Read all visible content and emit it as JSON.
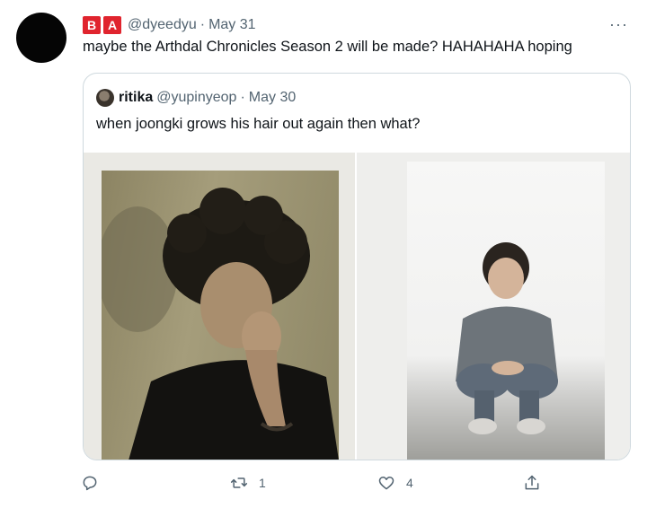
{
  "tweet": {
    "badge_b": "B",
    "badge_a": "A",
    "handle": "@dyeedyu",
    "separator": "·",
    "date": "May 31",
    "more": "···",
    "text": "maybe the Arthdal Chronicles Season 2 will be made? HAHAHAHA hoping"
  },
  "quoted": {
    "name": "ritika",
    "handle": "@yupinyeop",
    "separator": "·",
    "date": "May 30",
    "text": "when joongki grows his hair out again then what?"
  },
  "actions": {
    "reply_count": "",
    "retweet_count": "1",
    "like_count": "4"
  },
  "colors": {
    "badge": "#e0242e",
    "secondary_text": "#536471",
    "border": "#cfd9de"
  }
}
